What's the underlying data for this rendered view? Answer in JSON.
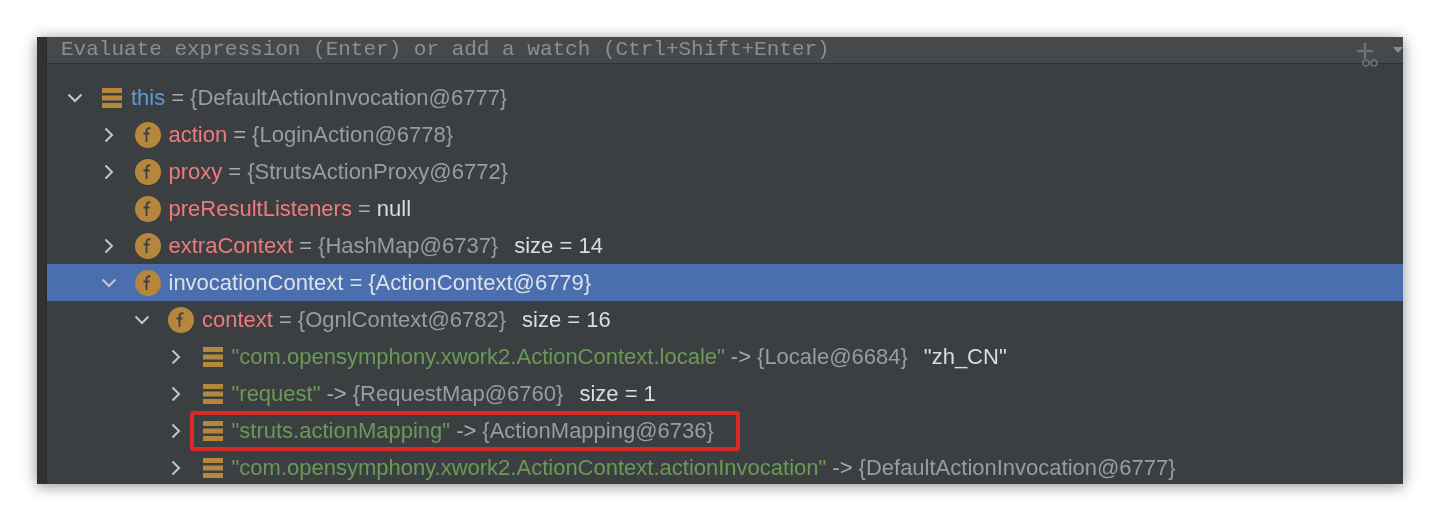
{
  "watch": {
    "placeholder": "Evaluate expression (Enter) or add a watch (Ctrl+Shift+Enter)"
  },
  "tree": [
    {
      "kind": "local",
      "expandable": true,
      "expanded": true,
      "selected": false,
      "highlighted": false,
      "name": "this",
      "separator": "=",
      "value": "{DefaultActionInvocation@6777}",
      "literal": false,
      "children": [
        {
          "kind": "field",
          "expandable": true,
          "expanded": false,
          "selected": false,
          "highlighted": false,
          "name": "action",
          "separator": "=",
          "value": "{LoginAction@6778}",
          "literal": false
        },
        {
          "kind": "field",
          "expandable": true,
          "expanded": false,
          "selected": false,
          "highlighted": false,
          "name": "proxy",
          "separator": "=",
          "value": "{StrutsActionProxy@6772}",
          "literal": false
        },
        {
          "kind": "field",
          "expandable": false,
          "selected": false,
          "highlighted": false,
          "name": "preResultListeners",
          "separator": "=",
          "value": "null",
          "literal": true
        },
        {
          "kind": "field",
          "expandable": true,
          "expanded": false,
          "selected": false,
          "highlighted": false,
          "name": "extraContext",
          "separator": "=",
          "value": "{HashMap@6737}",
          "literal": false,
          "extra": "size = 14"
        },
        {
          "kind": "field",
          "expandable": true,
          "expanded": true,
          "selected": true,
          "highlighted": false,
          "name": "invocationContext",
          "separator": "=",
          "value": "{ActionContext@6779}",
          "literal": false,
          "children": [
            {
              "kind": "field",
              "expandable": true,
              "expanded": true,
              "selected": false,
              "highlighted": false,
              "name": "context",
              "separator": "=",
              "value": "{OgnlContext@6782}",
              "literal": false,
              "extra": "size = 16",
              "children": [
                {
                  "kind": "entry",
                  "expandable": true,
                  "expanded": false,
                  "selected": false,
                  "highlighted": false,
                  "name": "\"com.opensymphony.xwork2.ActionContext.locale\"",
                  "separator": "->",
                  "value": "{Locale@6684}",
                  "literal": false,
                  "extra": "\"zh_CN\""
                },
                {
                  "kind": "entry",
                  "expandable": true,
                  "expanded": false,
                  "selected": false,
                  "highlighted": false,
                  "name": "\"request\"",
                  "separator": "->",
                  "value": "{RequestMap@6760}",
                  "literal": false,
                  "extra": "size = 1"
                },
                {
                  "kind": "entry",
                  "expandable": true,
                  "expanded": false,
                  "selected": false,
                  "highlighted": true,
                  "name": "\"struts.actionMapping\"",
                  "separator": "->",
                  "value": "{ActionMapping@6736}",
                  "literal": false
                },
                {
                  "kind": "entry",
                  "expandable": true,
                  "expanded": false,
                  "selected": false,
                  "highlighted": false,
                  "name": "\"com.opensymphony.xwork2.ActionContext.actionInvocation\"",
                  "separator": "->",
                  "value": "{DefaultActionInvocation@6777}",
                  "literal": false
                }
              ]
            }
          ]
        }
      ]
    }
  ]
}
